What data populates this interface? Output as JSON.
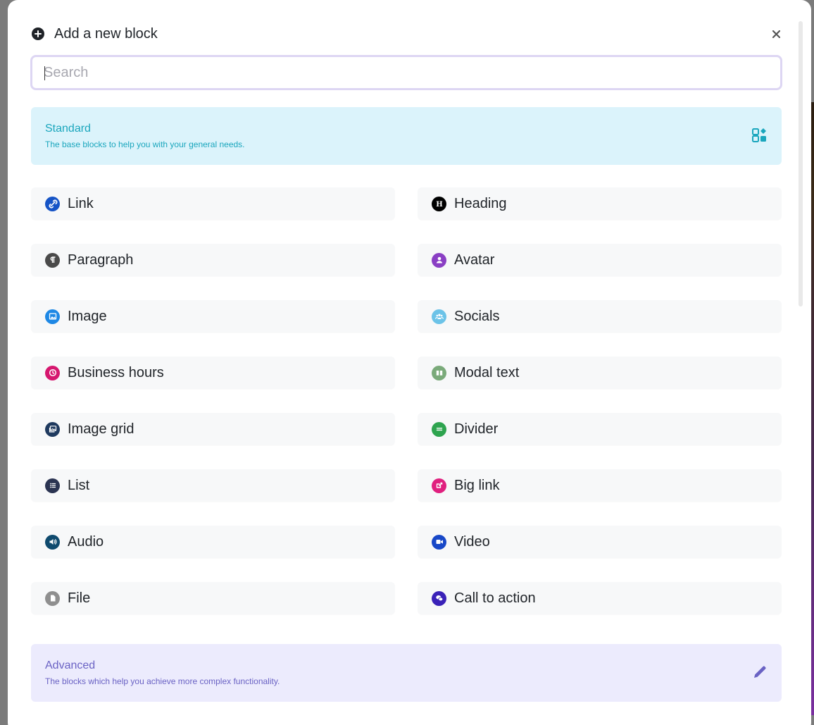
{
  "modal": {
    "title": "Add a new block",
    "close_label": "×"
  },
  "search": {
    "placeholder": "Search",
    "value": ""
  },
  "categories": [
    {
      "name": "Standard",
      "description": "The base blocks to help you with your general needs.",
      "icon": "blocks-icon",
      "color": "#1aa6bd",
      "background": "#dbf3fb"
    },
    {
      "name": "Advanced",
      "description": "The blocks which help you achieve more complex functionality.",
      "icon": "pencil-icon",
      "color": "#6a62c4",
      "background": "#ecebfd"
    }
  ],
  "blocks": [
    {
      "label": "Link",
      "icon": "link-icon",
      "color": "#1654c6"
    },
    {
      "label": "Heading",
      "icon": "heading-icon",
      "color": "#000000"
    },
    {
      "label": "Paragraph",
      "icon": "paragraph-icon",
      "color": "#4a4a4a"
    },
    {
      "label": "Avatar",
      "icon": "user-icon",
      "color": "#8a3fc4"
    },
    {
      "label": "Image",
      "icon": "image-icon",
      "color": "#1e88e5"
    },
    {
      "label": "Socials",
      "icon": "users-icon",
      "color": "#6cc3e8"
    },
    {
      "label": "Business hours",
      "icon": "clock-icon",
      "color": "#d6176f"
    },
    {
      "label": "Modal text",
      "icon": "book-icon",
      "color": "#7aaa7a"
    },
    {
      "label": "Image grid",
      "icon": "images-icon",
      "color": "#1f3a5f"
    },
    {
      "label": "Divider",
      "icon": "divider-icon",
      "color": "#2ea44f"
    },
    {
      "label": "List",
      "icon": "list-icon",
      "color": "#2b3452"
    },
    {
      "label": "Big link",
      "icon": "external-link-icon",
      "color": "#e0207f"
    },
    {
      "label": "Audio",
      "icon": "volume-icon",
      "color": "#0f4a6e"
    },
    {
      "label": "Video",
      "icon": "video-icon",
      "color": "#1848c8"
    },
    {
      "label": "File",
      "icon": "file-icon",
      "color": "#8f8f8f"
    },
    {
      "label": "Call to action",
      "icon": "comments-icon",
      "color": "#3a22b8"
    }
  ]
}
